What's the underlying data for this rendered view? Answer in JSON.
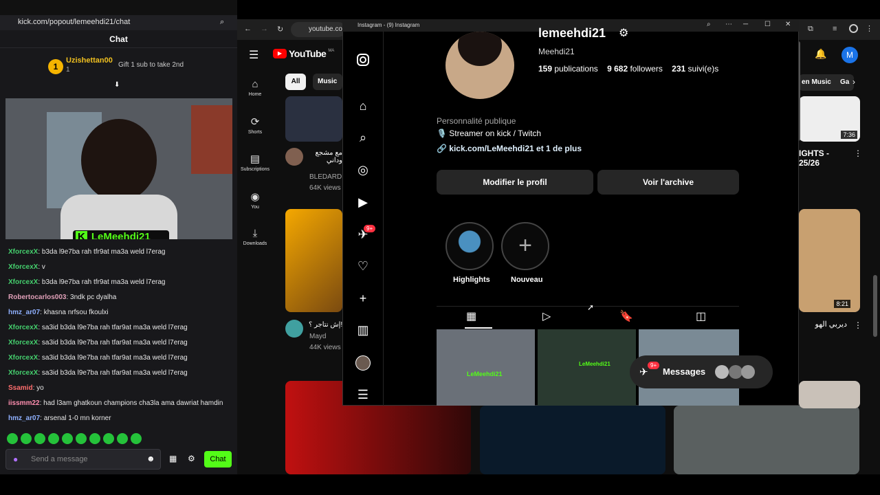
{
  "kick": {
    "url": "kick.com/popout/lemeehdi21/chat",
    "title": "Chat",
    "gift_user": "Uzishettan00",
    "gift_count": "1",
    "gift_text": "Gift 1 sub to take 2nd",
    "streamer": "LeMeehdi21",
    "send_placeholder": "Send a message",
    "chat_btn": "Chat",
    "messages": [
      {
        "user": "XforcexX",
        "text": "b3da l9e7ba rah tfr9at ma3a weld l7erag",
        "color": "#45d06e"
      },
      {
        "user": "XforcexX",
        "text": "v",
        "color": "#45d06e"
      },
      {
        "user": "XforcexX",
        "text": "b3da l9e7ba rah tfr9at ma3a weld l7erag",
        "color": "#45d06e"
      },
      {
        "user": "Robertocarlos003",
        "text": "3ndk pc dyalha",
        "color": "#e0a0b8"
      },
      {
        "user": "hmz_ar07",
        "text": "khasna nrfsou fkoulxi",
        "color": "#8fb0ff"
      },
      {
        "user": "XforcexX",
        "text": "sa3id b3da l9e7ba rah tfar9at ma3a weld l7erag",
        "color": "#45d06e"
      },
      {
        "user": "XforcexX",
        "text": "sa3id b3da l9e7ba rah tfar9at ma3a weld l7erag",
        "color": "#45d06e"
      },
      {
        "user": "XforcexX",
        "text": "sa3id b3da l9e7ba rah tfar9at ma3a weld l7erag",
        "color": "#45d06e"
      },
      {
        "user": "XforcexX",
        "text": "sa3id b3da l9e7ba rah tfar9at ma3a weld l7erag",
        "color": "#45d06e"
      },
      {
        "user": "Ssamid",
        "text": "yo",
        "color": "#ff6e6e"
      },
      {
        "user": "iissmm22",
        "text": "had l3am ghatkoun champions cha3la ama dawriat hamdin",
        "color": "#ff8fb0"
      },
      {
        "user": "hmz_ar07",
        "text": "arsenal 1-0 mn korner",
        "color": "#8fb0ff"
      }
    ]
  },
  "youtube": {
    "url": "youtube.com",
    "logo": "YouTube",
    "region": "MA",
    "chips": [
      "All",
      "Music"
    ],
    "nav": [
      "Home",
      "Shorts",
      "Subscriptions",
      "You",
      "Downloads"
    ],
    "videos": [
      {
        "title": "مع مشجع وداني",
        "channel": "BLEDARD",
        "views": "64K views"
      },
      {
        "title": "إش نتاجر ؟!",
        "channel": "Mayd",
        "views": "44K views"
      }
    ],
    "right_chip": "en Music",
    "right_chip2": "Ga",
    "right_title": "IGHTS - 25/26",
    "duration1": "7:36",
    "duration2": "8:21",
    "arabic_title": "ديربي الهو",
    "avatar_letter": "M"
  },
  "instagram": {
    "window_title": "Instagram - (9) Instagram",
    "username": "lemeehdi21",
    "full_name": "Meehdi21",
    "publications": "159",
    "publications_label": "publications",
    "followers": "9 682",
    "followers_label": "followers",
    "following": "231",
    "following_label": "suivi(e)s",
    "category": "Personnalité publique",
    "bio": "🎙️ Streamer on kick / Twitch",
    "link": "kick.com/LeMeehdi21 et 1 de plus",
    "edit_btn": "Modifier le profil",
    "archive_btn": "Voir l'archive",
    "highlights": "Highlights",
    "new": "Nouveau",
    "messages": "Messages",
    "notif_badge": "9+",
    "post_label": "LeMeehdi21"
  }
}
